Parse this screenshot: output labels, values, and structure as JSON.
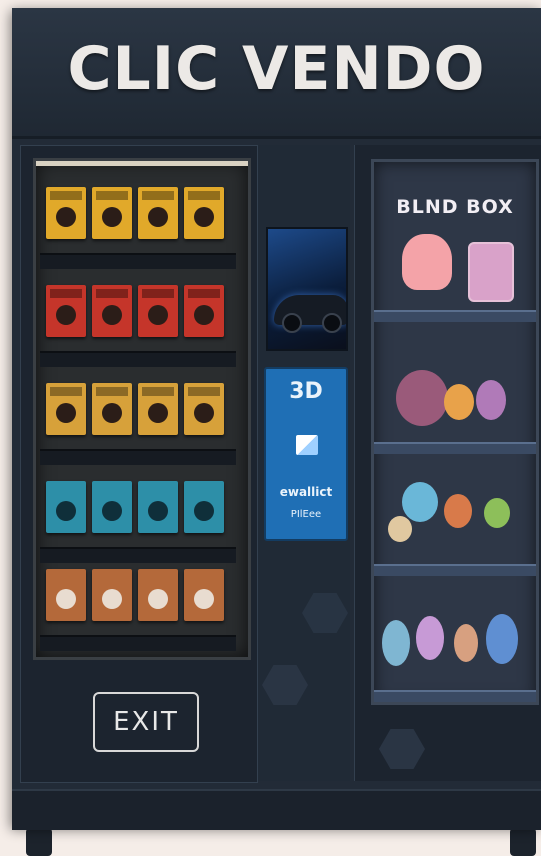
{
  "header": {
    "brand": "CLIC VENDO"
  },
  "left_panel": {
    "exit_label": "EXIT",
    "shelves": [
      {
        "color": "#e1a92a"
      },
      {
        "color": "#c5352a"
      },
      {
        "color": "#d7a13a"
      },
      {
        "color": "#2d8fa8"
      },
      {
        "color": "#b4693a"
      }
    ]
  },
  "middle_panel": {
    "info_title": "3D",
    "info_brand": "ewallict",
    "info_footer": "PIlEee"
  },
  "right_panel": {
    "title": "BLND BOX"
  }
}
